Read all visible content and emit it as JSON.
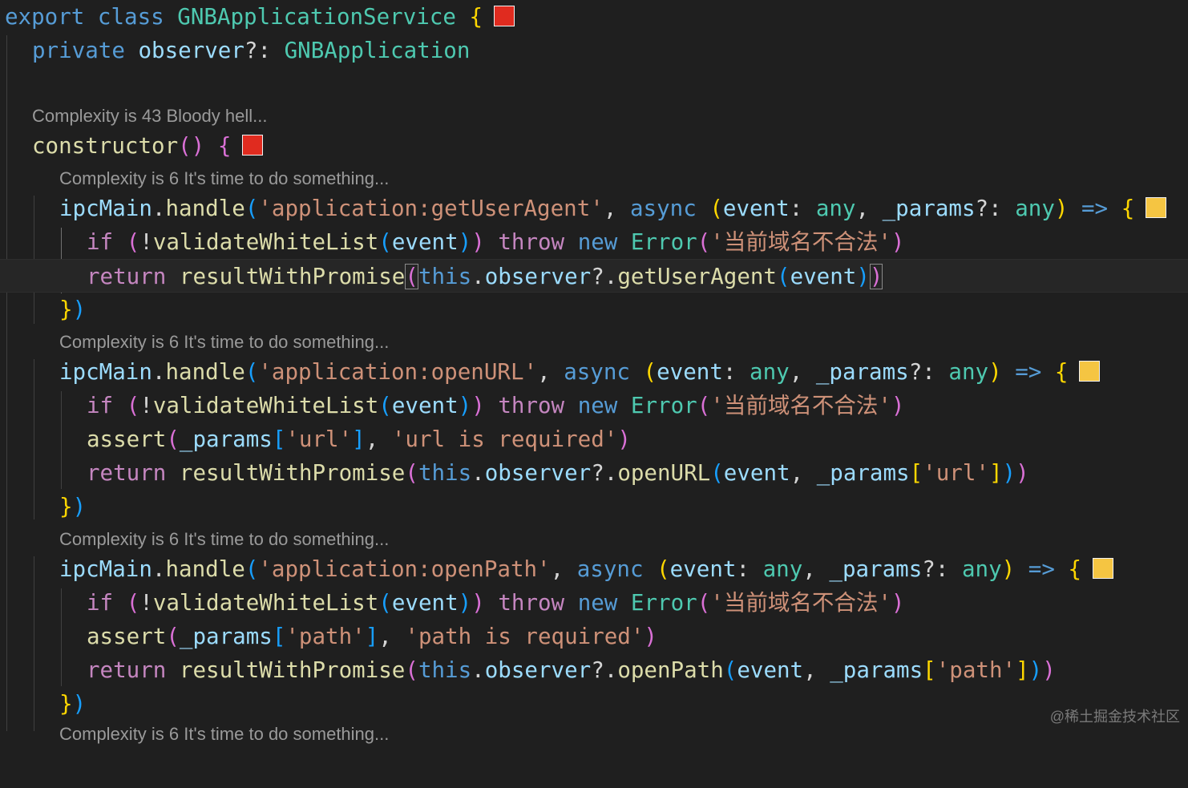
{
  "colors": {
    "background": "#1f1f1f",
    "keyword": "#569cd6",
    "control": "#c586c0",
    "type": "#4ec9b0",
    "function": "#dcdcaa",
    "variable": "#9cdcfe",
    "string": "#ce9178",
    "complexity_high": "#e02b1f",
    "complexity_medium": "#f5c542"
  },
  "code": {
    "line1": {
      "export": "export",
      "class": "class",
      "name": "GNBApplicationService",
      "brace": "{"
    },
    "line2": {
      "private": "private",
      "prop": "observer",
      "opt": "?:",
      "type": "GNBApplication"
    },
    "lens_constructor": "Complexity is 43 Bloody hell...",
    "ctor": {
      "name": "constructor",
      "parens": "()",
      "brace": "{"
    },
    "lens_handler": "Complexity is 6 It's time to do something...",
    "h1": {
      "channel": "'application:getUserAgent'",
      "method_call": "getUserAgent"
    },
    "h2": {
      "channel": "'application:openURL'",
      "key": "'url'",
      "msg": "'url is required'",
      "method_call": "openURL"
    },
    "h3": {
      "channel": "'application:openPath'",
      "key": "'path'",
      "msg": "'path is required'",
      "method_call": "openPath"
    },
    "tokens": {
      "ipcMain": "ipcMain",
      "dot": ".",
      "handle": "handle",
      "lp": "(",
      "rp": ")",
      "comma": ",",
      "async": "async",
      "event": "event",
      "colon": ":",
      "any": "any",
      "params": "_params",
      "optcolon": "?:",
      "arrow": "=>",
      "lbrace": "{",
      "rbrace": "}",
      "if": "if",
      "not": "!",
      "validate": "validateWhiteList",
      "throw": "throw",
      "new": "new",
      "Error": "Error",
      "errmsg": "'当前域名不合法'",
      "return": "return",
      "rwp": "resultWithPromise",
      "this": "this",
      "observer": "observer",
      "optdot": "?.",
      "assert": "assert",
      "lb": "[",
      "rb": "]"
    }
  },
  "watermark": "@稀土掘金技术社区"
}
